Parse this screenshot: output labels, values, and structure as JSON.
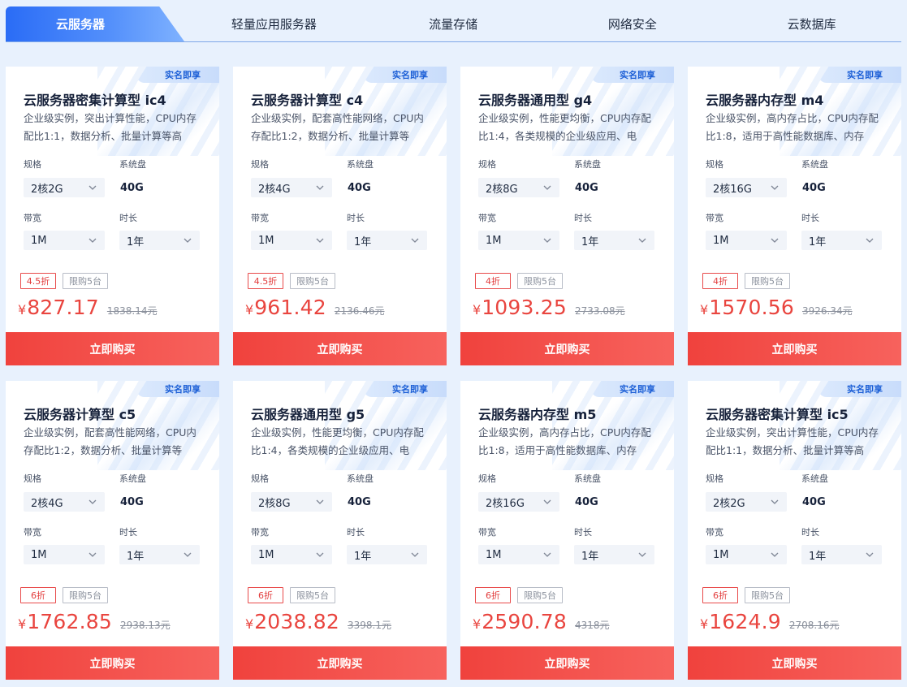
{
  "tabs": [
    {
      "label": "云服务器",
      "active": true
    },
    {
      "label": "轻量应用服务器",
      "active": false
    },
    {
      "label": "流量存储",
      "active": false
    },
    {
      "label": "网络安全",
      "active": false
    },
    {
      "label": "云数据库",
      "active": false
    }
  ],
  "labels": {
    "spec": "规格",
    "disk": "系统盘",
    "bandwidth": "带宽",
    "duration": "时长",
    "buy": "立即购买",
    "badge": "实名即享",
    "currency": "¥"
  },
  "colors": {
    "accent": "#2a6cf6",
    "price": "#e9453f",
    "buy_button": "#f0423d",
    "background": "#e8f1fd"
  },
  "cards": [
    {
      "title": "云服务器密集计算型 ic4",
      "desc": "企业级实例，突出计算性能，CPU内存配比1:1，数据分析、批量计算等高",
      "spec": "2核2G",
      "disk": "40G",
      "bandwidth": "1M",
      "duration": "1年",
      "discount": "4.5折",
      "limit": "限购5台",
      "price": "827.17",
      "original": "1838.14元"
    },
    {
      "title": "云服务器计算型 c4",
      "desc": "企业级实例，配套高性能网络，CPU内存配比1:2，数据分析、批量计算等",
      "spec": "2核4G",
      "disk": "40G",
      "bandwidth": "1M",
      "duration": "1年",
      "discount": "4.5折",
      "limit": "限购5台",
      "price": "961.42",
      "original": "2136.46元"
    },
    {
      "title": "云服务器通用型 g4",
      "desc": "企业级实例，性能更均衡，CPU内存配比1:4，各类规模的企业级应用、电",
      "spec": "2核8G",
      "disk": "40G",
      "bandwidth": "1M",
      "duration": "1年",
      "discount": "4折",
      "limit": "限购5台",
      "price": "1093.25",
      "original": "2733.08元"
    },
    {
      "title": "云服务器内存型 m4",
      "desc": "企业级实例，高内存占比，CPU内存配比1:8，适用于高性能数据库、内存",
      "spec": "2核16G",
      "disk": "40G",
      "bandwidth": "1M",
      "duration": "1年",
      "discount": "4折",
      "limit": "限购5台",
      "price": "1570.56",
      "original": "3926.34元"
    },
    {
      "title": "云服务器计算型 c5",
      "desc": "企业级实例，配套高性能网络，CPU内存配比1:2，数据分析、批量计算等",
      "spec": "2核4G",
      "disk": "40G",
      "bandwidth": "1M",
      "duration": "1年",
      "discount": "6折",
      "limit": "限购5台",
      "price": "1762.85",
      "original": "2938.13元"
    },
    {
      "title": "云服务器通用型 g5",
      "desc": "企业级实例，性能更均衡，CPU内存配比1:4，各类规模的企业级应用、电",
      "spec": "2核8G",
      "disk": "40G",
      "bandwidth": "1M",
      "duration": "1年",
      "discount": "6折",
      "limit": "限购5台",
      "price": "2038.82",
      "original": "3398.1元"
    },
    {
      "title": "云服务器内存型 m5",
      "desc": "企业级实例，高内存占比，CPU内存配比1:8，适用于高性能数据库、内存",
      "spec": "2核16G",
      "disk": "40G",
      "bandwidth": "1M",
      "duration": "1年",
      "discount": "6折",
      "limit": "限购5台",
      "price": "2590.78",
      "original": "4318元"
    },
    {
      "title": "云服务器密集计算型 ic5",
      "desc": "企业级实例，突出计算性能，CPU内存配比1:1，数据分析、批量计算等高",
      "spec": "2核2G",
      "disk": "40G",
      "bandwidth": "1M",
      "duration": "1年",
      "discount": "6折",
      "limit": "限购5台",
      "price": "1624.9",
      "original": "2708.16元"
    }
  ]
}
